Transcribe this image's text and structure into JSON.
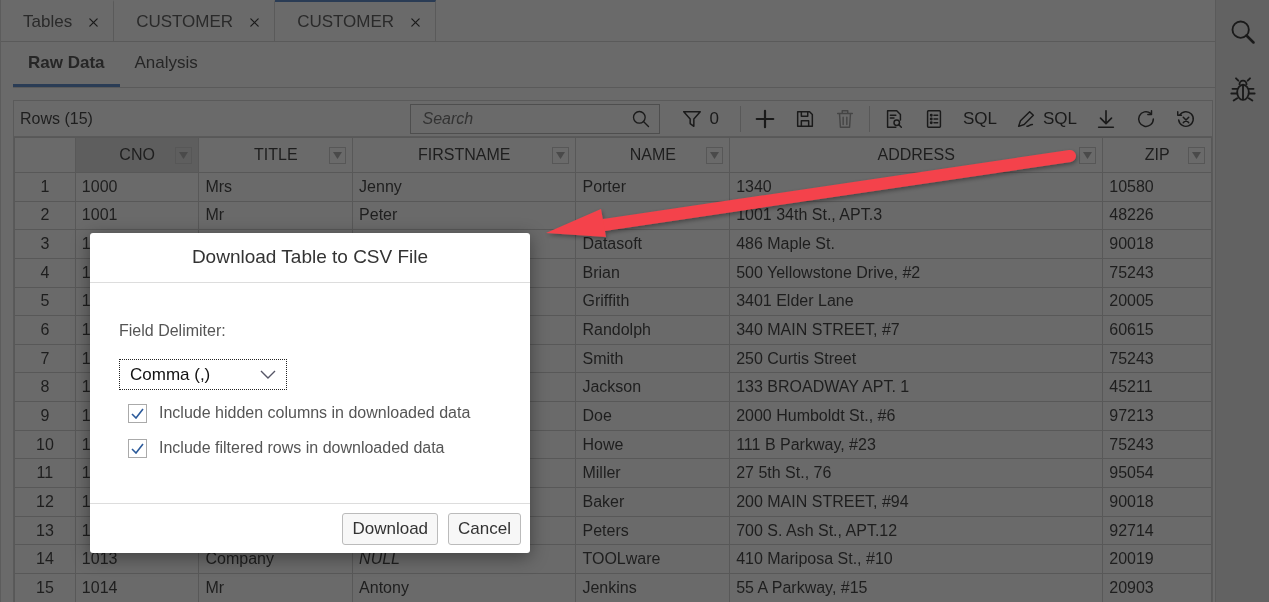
{
  "doc_tabs": [
    {
      "label": "Tables",
      "selected": false
    },
    {
      "label": "CUSTOMER",
      "selected": false
    },
    {
      "label": "CUSTOMER",
      "selected": true
    }
  ],
  "view_tabs": [
    {
      "label": "Raw Data",
      "selected": true
    },
    {
      "label": "Analysis",
      "selected": false
    }
  ],
  "toolbar": {
    "row_count": "Rows (15)",
    "search": {
      "placeholder": "Search"
    },
    "filter_count": "0",
    "buttons": [
      {
        "disabled": false
      },
      {
        "disabled": false
      },
      {
        "disabled": true
      },
      {
        "disabled": false
      },
      {
        "disabled": false
      },
      {
        "text": "SQL",
        "disabled": false
      },
      {
        "text": "SQL",
        "disabled": false
      },
      {
        "disabled": false
      },
      {
        "disabled": false
      },
      {
        "disabled": false
      }
    ]
  },
  "table": {
    "columns": [
      {
        "label": "CNO",
        "selected": true
      },
      {
        "label": "TITLE",
        "selected": false
      },
      {
        "label": "FIRSTNAME",
        "selected": false
      },
      {
        "label": "NAME",
        "selected": false
      },
      {
        "label": "ADDRESS",
        "selected": false
      },
      {
        "label": "ZIP",
        "selected": false
      }
    ],
    "rows": [
      {
        "num": "1",
        "cells": [
          "1000",
          "Mrs",
          "Jenny",
          "Porter",
          "1340",
          "10580"
        ]
      },
      {
        "num": "2",
        "cells": [
          "1001",
          "Mr",
          "Peter",
          null,
          "1001 34th St., APT.3",
          "48226"
        ]
      },
      {
        "num": "3",
        "cells": [
          "1",
          null,
          null,
          "Datasoft",
          "486 Maple St.",
          "90018"
        ]
      },
      {
        "num": "4",
        "cells": [
          "1",
          null,
          null,
          "Brian",
          "500 Yellowstone Drive, #2",
          "75243"
        ]
      },
      {
        "num": "5",
        "cells": [
          "1",
          null,
          null,
          "Griffith",
          "3401 Elder Lane",
          "20005"
        ]
      },
      {
        "num": "6",
        "cells": [
          "1",
          null,
          null,
          "Randolph",
          "340 MAIN STREET, #7",
          "60615"
        ]
      },
      {
        "num": "7",
        "cells": [
          "1",
          null,
          null,
          "Smith",
          "250 Curtis Street",
          "75243"
        ]
      },
      {
        "num": "8",
        "cells": [
          "1",
          null,
          null,
          "Jackson",
          "133 BROADWAY APT. 1",
          "45211"
        ]
      },
      {
        "num": "9",
        "cells": [
          "1",
          null,
          null,
          "Doe",
          "2000 Humboldt St., #6",
          "97213"
        ]
      },
      {
        "num": "10",
        "cells": [
          "1",
          null,
          null,
          "Howe",
          "111 B Parkway, #23",
          "75243"
        ]
      },
      {
        "num": "11",
        "cells": [
          "1",
          null,
          null,
          "Miller",
          "27 5th St., 76",
          "95054"
        ]
      },
      {
        "num": "12",
        "cells": [
          "1",
          null,
          null,
          "Baker",
          "200 MAIN STREET, #94",
          "90018"
        ]
      },
      {
        "num": "13",
        "cells": [
          "1",
          null,
          null,
          "Peters",
          "700 S. Ash St., APT.12",
          "92714"
        ]
      },
      {
        "num": "14",
        "cells": [
          "1013",
          "Company",
          {
            "text": "NULL",
            "kind": "null"
          },
          "TOOLware",
          "410 Mariposa St., #10",
          "20019"
        ]
      },
      {
        "num": "15",
        "cells": [
          "1014",
          "Mr",
          "Antony",
          "Jenkins",
          "55 A Parkway, #15",
          "20903"
        ]
      }
    ]
  },
  "dialog": {
    "title": "Download Table to CSV File",
    "delimiter_label": "Field Delimiter:",
    "delimiter_value": "Comma (,)",
    "options": [
      {
        "label": "Include hidden columns in downloaded data",
        "checked": true
      },
      {
        "label": "Include filtered rows in downloaded data",
        "checked": true
      }
    ],
    "buttons": [
      "Download",
      "Cancel"
    ]
  }
}
